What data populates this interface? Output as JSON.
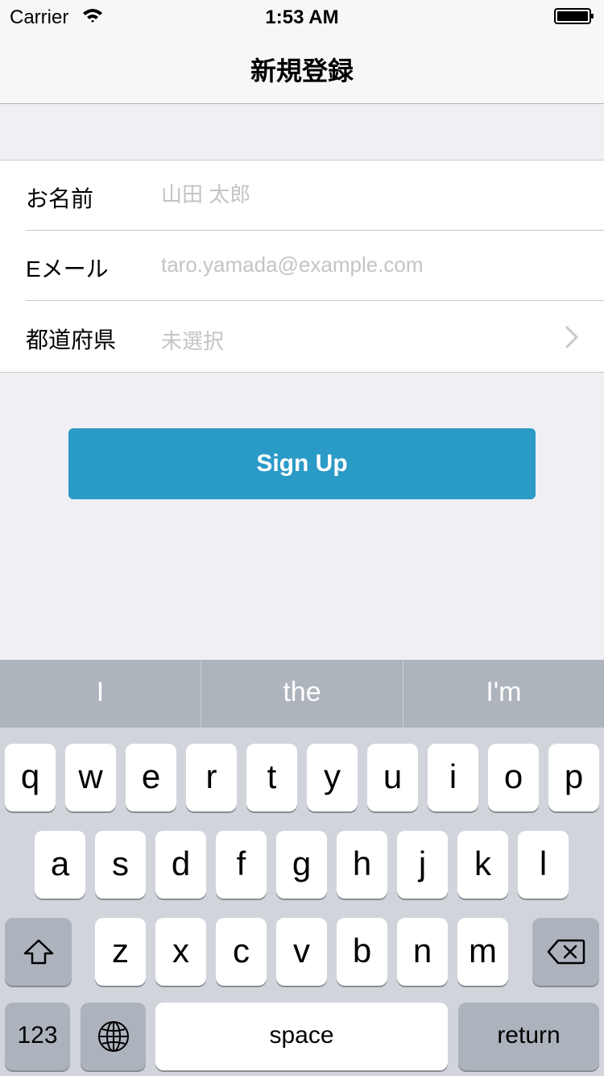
{
  "status_bar": {
    "carrier": "Carrier",
    "time": "1:53 AM"
  },
  "nav": {
    "title": "新規登録"
  },
  "form": {
    "name_label": "お名前",
    "name_placeholder": "山田 太郎",
    "email_label": "Eメール",
    "email_placeholder": "taro.yamada@example.com",
    "prefecture_label": "都道府県",
    "prefecture_value": "未選択"
  },
  "signup_button": {
    "label": "Sign Up"
  },
  "keyboard": {
    "suggestions": [
      "I",
      "the",
      "I'm"
    ],
    "rows": [
      [
        "q",
        "w",
        "e",
        "r",
        "t",
        "y",
        "u",
        "i",
        "o",
        "p"
      ],
      [
        "a",
        "s",
        "d",
        "f",
        "g",
        "h",
        "j",
        "k",
        "l"
      ],
      [
        "z",
        "x",
        "c",
        "v",
        "b",
        "n",
        "m"
      ]
    ],
    "numbers_label": "123",
    "space_label": "space",
    "return_label": "return"
  },
  "icons": {
    "status": [
      "wifi-icon",
      "battery-icon"
    ],
    "form": [
      "chevron-right-icon"
    ],
    "keyboard": [
      "shift-icon",
      "backspace-icon",
      "globe-icon"
    ]
  },
  "colors": {
    "accent": "#2a9ac7",
    "background": "#efeff4",
    "keyboard_background": "#d1d5db",
    "placeholder": "#c4c4c8"
  }
}
